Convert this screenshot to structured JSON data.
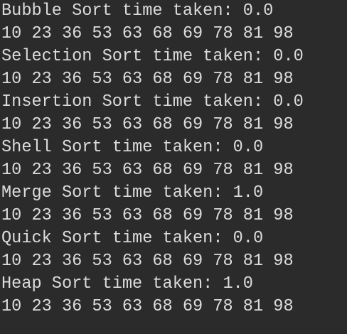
{
  "console": {
    "lines": [
      "Bubble Sort time taken: 0.0",
      "10 23 36 53 63 68 69 78 81 98",
      "Selection Sort time taken: 0.0",
      "10 23 36 53 63 68 69 78 81 98",
      "Insertion Sort time taken: 0.0",
      "10 23 36 53 63 68 69 78 81 98",
      "Shell Sort time taken: 0.0",
      "10 23 36 53 63 68 69 78 81 98",
      "Merge Sort time taken: 1.0",
      "10 23 36 53 63 68 69 78 81 98",
      "Quick Sort time taken: 0.0",
      "10 23 36 53 63 68 69 78 81 98",
      "Heap Sort time taken: 1.0",
      "10 23 36 53 63 68 69 78 81 98"
    ]
  },
  "colors": {
    "background": "#2b2b2b",
    "text": "#dcdcdc"
  }
}
